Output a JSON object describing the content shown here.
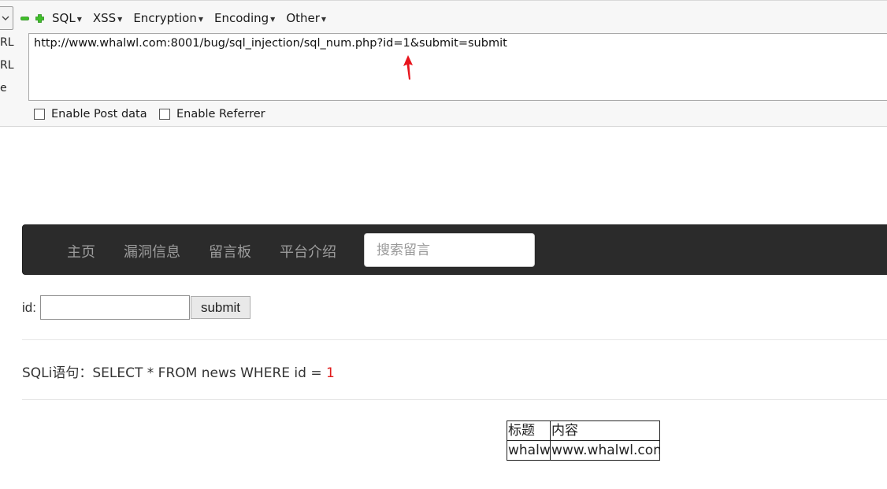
{
  "hackbar": {
    "menu": [
      "SQL",
      "XSS",
      "Encryption",
      "Encoding",
      "Other"
    ],
    "side_labels": [
      "RL",
      "RL",
      "e"
    ],
    "url": "http://www.whalwl.com:8001/bug/sql_injection/sql_num.php?id=1&submit=submit",
    "enable_post": "Enable Post data",
    "enable_referrer": "Enable Referrer"
  },
  "nav": {
    "items": [
      "主页",
      "漏洞信息",
      "留言板",
      "平台介绍"
    ],
    "search_placeholder": "搜索留言"
  },
  "form": {
    "id_label": "id:",
    "submit_label": "submit"
  },
  "sqli": {
    "prefix": "SQLi语句：SELECT * FROM news WHERE id = ",
    "value": "1"
  },
  "result_table": {
    "headers": [
      "标题",
      "内容"
    ],
    "rows": [
      [
        "whalwl",
        "www.whalwl.com."
      ]
    ]
  },
  "colors": {
    "navbar_bg": "#2b2b2b",
    "sql_value": "#e01b1b",
    "arrow": "#e8141c"
  }
}
